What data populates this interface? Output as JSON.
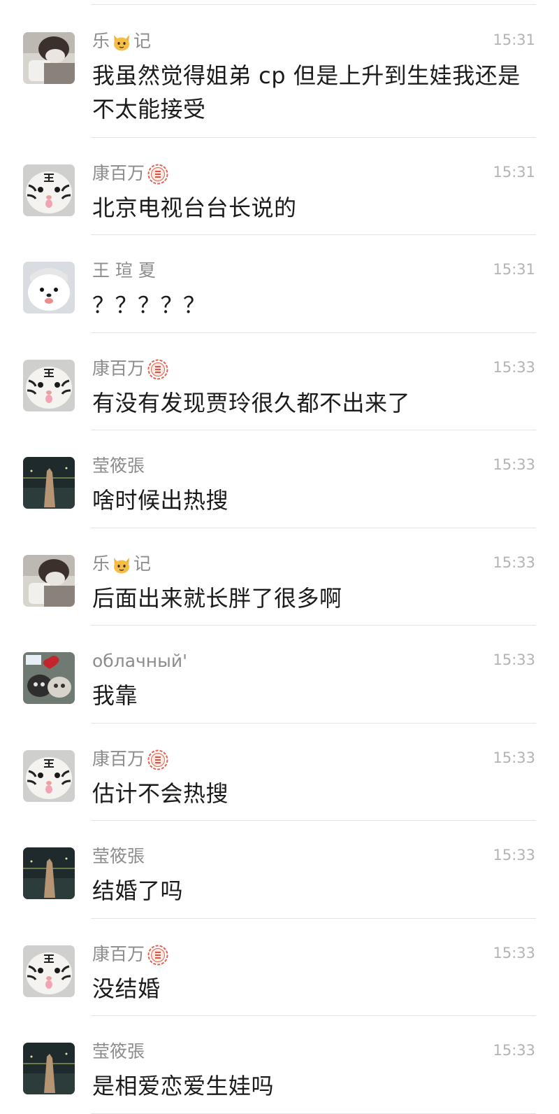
{
  "messages": [
    {
      "name": "乐",
      "name_suffix": "记",
      "name_icon": "cat-face-emoji",
      "avatar": "cat-avatar",
      "time": "15:31",
      "text": "我虽然觉得姐弟 cp 但是上升到生娃我还是不太能接受"
    },
    {
      "name": "康百万",
      "name_suffix": "",
      "name_icon": "red-seal-badge",
      "avatar": "white-tiger-avatar",
      "time": "15:31",
      "text": "北京电视台台长说的"
    },
    {
      "name": "王 瑄 夏",
      "name_suffix": "",
      "name_icon": "",
      "avatar": "white-dog-avatar",
      "time": "15:31",
      "text": "？？？？？"
    },
    {
      "name": "康百万",
      "name_suffix": "",
      "name_icon": "red-seal-badge",
      "avatar": "white-tiger-avatar",
      "time": "15:33",
      "text": "有没有发现贾玲很久都不出来了"
    },
    {
      "name": "莹筱張",
      "name_suffix": "",
      "name_icon": "",
      "avatar": "night-scene-avatar",
      "time": "15:33",
      "text": "啥时候出热搜"
    },
    {
      "name": "乐",
      "name_suffix": "记",
      "name_icon": "cat-face-emoji",
      "avatar": "cat-avatar",
      "time": "15:33",
      "text": "后面出来就长胖了很多啊"
    },
    {
      "name": "облачный'",
      "name_suffix": "",
      "name_icon": "",
      "avatar": "sticker-cats-avatar",
      "time": "15:33",
      "text": "我靠"
    },
    {
      "name": "康百万",
      "name_suffix": "",
      "name_icon": "red-seal-badge",
      "avatar": "white-tiger-avatar",
      "time": "15:33",
      "text": "估计不会热搜"
    },
    {
      "name": "莹筱張",
      "name_suffix": "",
      "name_icon": "",
      "avatar": "night-scene-avatar",
      "time": "15:33",
      "text": "结婚了吗"
    },
    {
      "name": "康百万",
      "name_suffix": "",
      "name_icon": "red-seal-badge",
      "avatar": "white-tiger-avatar",
      "time": "15:33",
      "text": "没结婚"
    },
    {
      "name": "莹筱張",
      "name_suffix": "",
      "name_icon": "",
      "avatar": "night-scene-avatar",
      "time": "15:33",
      "text": "是相爱恋爱生娃吗"
    }
  ]
}
